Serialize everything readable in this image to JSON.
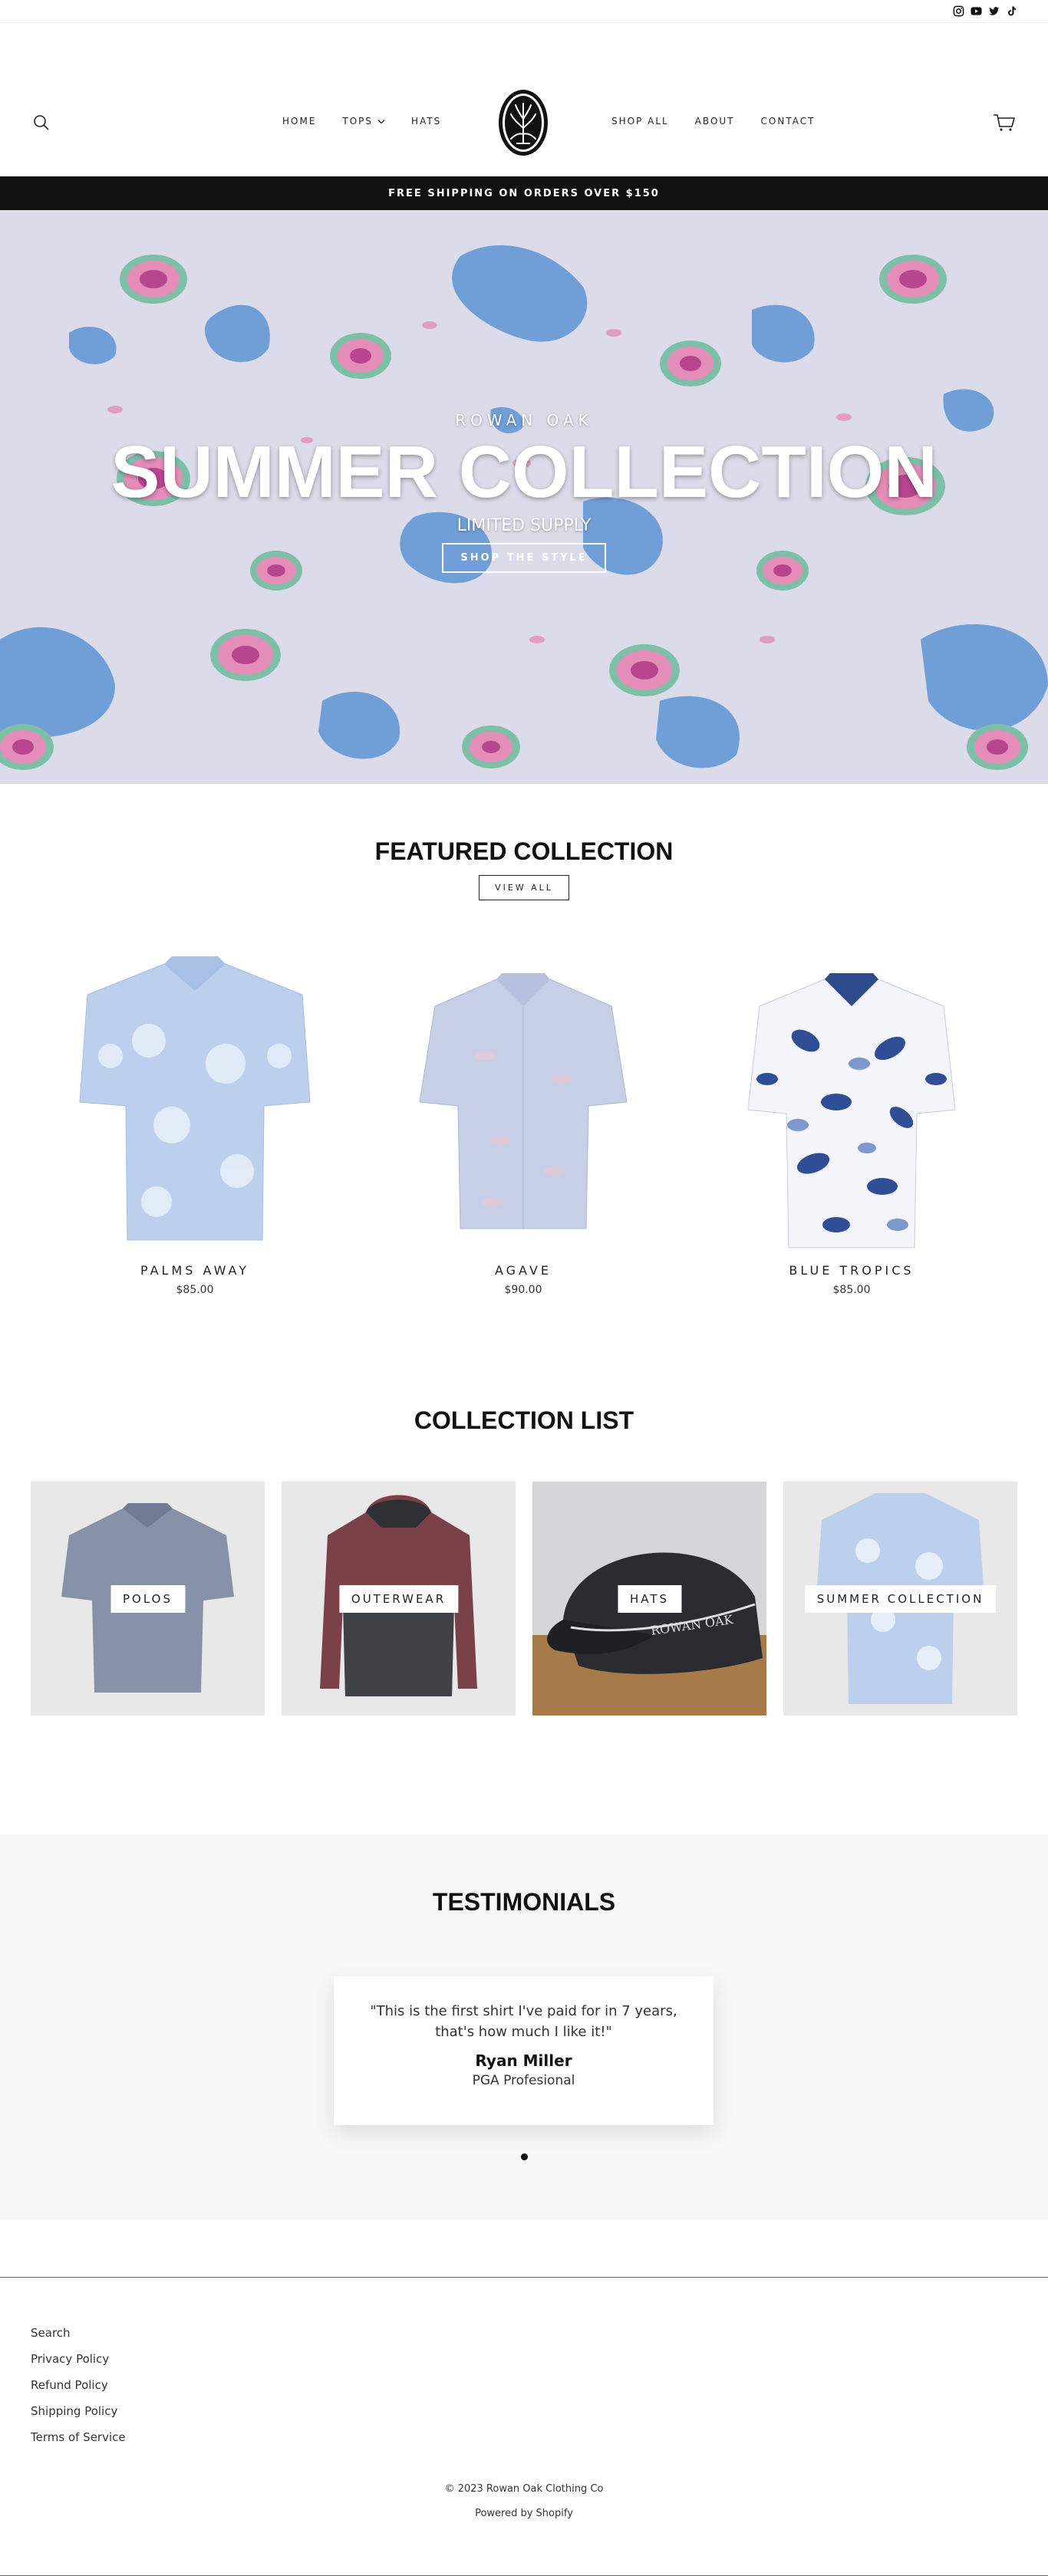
{
  "social": {
    "icons": [
      "instagram-icon",
      "youtube-icon",
      "twitter-icon",
      "tiktok-icon"
    ]
  },
  "header": {
    "nav_left": [
      {
        "label": "HOME"
      },
      {
        "label": "TOPS",
        "has_dropdown": true
      },
      {
        "label": "HATS"
      }
    ],
    "nav_right": [
      {
        "label": "SHOP ALL"
      },
      {
        "label": "ABOUT"
      },
      {
        "label": "CONTACT"
      }
    ]
  },
  "announcement": {
    "text": "FREE SHIPPING ON ORDERS OVER $150"
  },
  "hero": {
    "eyebrow": "ROWAN OAK",
    "title": "SUMMER COLLECTION",
    "subtitle": "LIMITED SUPPLY",
    "button": "SHOP THE STYLE"
  },
  "featured": {
    "title": "FEATURED COLLECTION",
    "view_all": "VIEW ALL",
    "products": [
      {
        "name": "PALMS AWAY",
        "price": "$85.00"
      },
      {
        "name": "AGAVE",
        "price": "$90.00"
      },
      {
        "name": "BLUE TROPICS",
        "price": "$85.00"
      }
    ]
  },
  "collections": {
    "title": "COLLECTION LIST",
    "items": [
      {
        "label": "POLOS"
      },
      {
        "label": "OUTERWEAR"
      },
      {
        "label": "HATS"
      },
      {
        "label": "SUMMER COLLECTION"
      }
    ],
    "hat_text": "ROWAN OAK"
  },
  "testimonials": {
    "title": "TESTIMONIALS",
    "quote": "\"This is the first shirt I've paid for in 7 years, that's how much I like it!\"",
    "name": "Ryan Miller",
    "role": "PGA Profesional"
  },
  "footer": {
    "links": [
      "Search",
      "Privacy Policy",
      "Refund Policy",
      "Shipping Policy",
      "Terms of Service"
    ],
    "copyright": "© 2023 Rowan Oak Clothing Co",
    "powered": "Powered by Shopify"
  },
  "colors": {
    "announcement_bg": "#111111",
    "hero_base": "#dcdbe9",
    "pattern_blue": "#6f9fd6",
    "pattern_pink": "#e48db8",
    "pattern_magenta": "#b7468f",
    "pattern_green": "#7ebfaa"
  }
}
